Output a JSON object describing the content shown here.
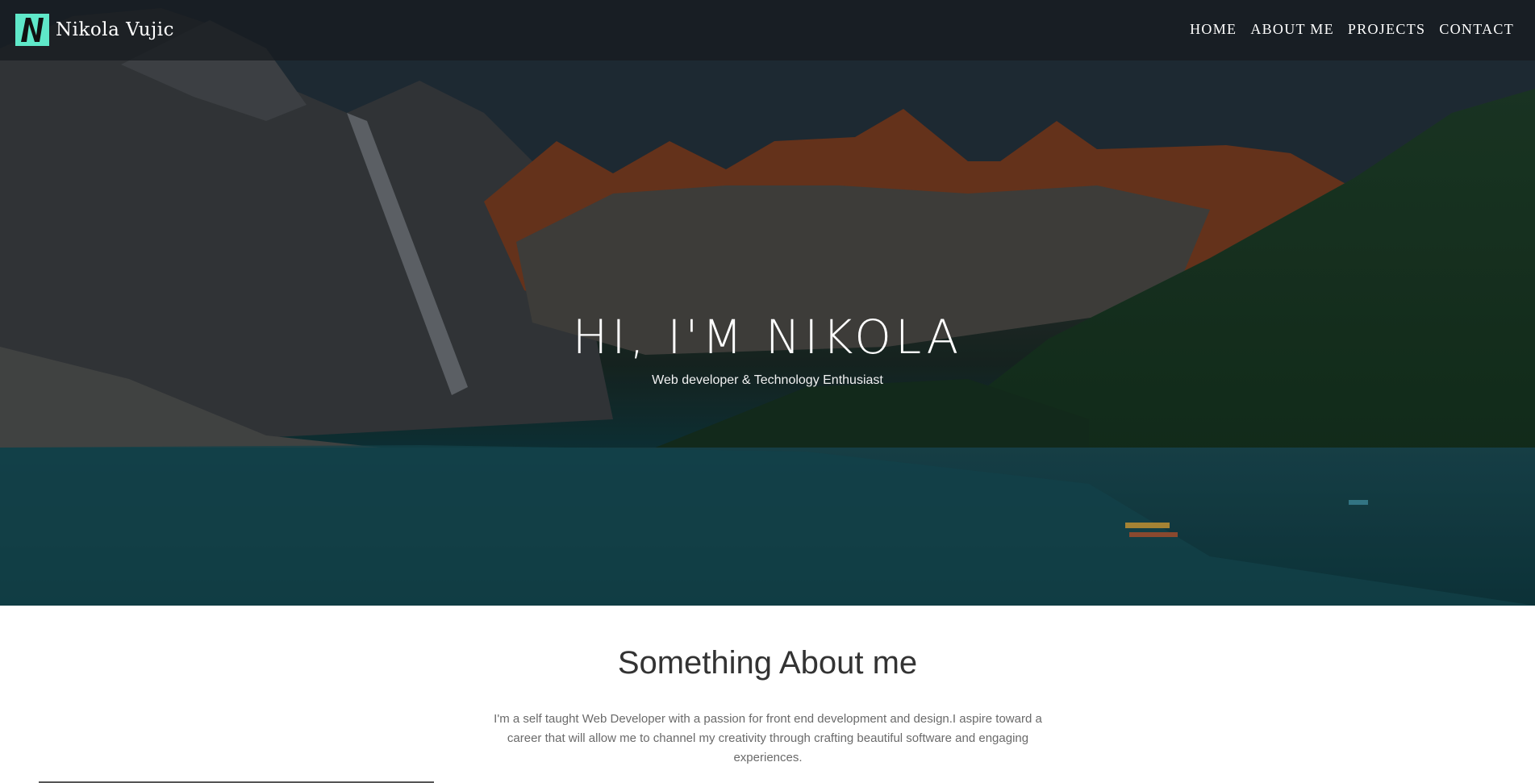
{
  "brand": {
    "name": "Nikola Vujic",
    "logo_letter": "N",
    "logo_color": "#5fe8c9"
  },
  "nav": {
    "items": [
      {
        "label": "HOME"
      },
      {
        "label": "ABOUT ME"
      },
      {
        "label": "PROJECTS"
      },
      {
        "label": "CONTACT"
      }
    ]
  },
  "hero": {
    "title": "HI, I'M NIKOLA",
    "subtitle": "Web developer & Technology Enthusiast"
  },
  "about": {
    "title": "Something About me",
    "text": "I'm a self taught Web Developer with a passion for front end development and design.I aspire toward a career that will allow me to channel my creativity through crafting beautiful software and engaging experiences."
  }
}
